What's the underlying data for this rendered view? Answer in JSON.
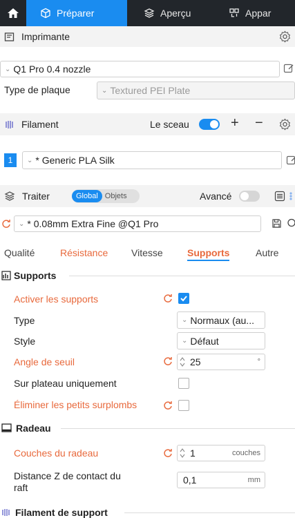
{
  "topbar": {
    "tabs": [
      {
        "label": "Préparer"
      },
      {
        "label": "Aperçu"
      },
      {
        "label": "Appar"
      }
    ]
  },
  "printer": {
    "title": "Imprimante",
    "preset": "Q1 Pro 0.4 nozzle",
    "plate_label": "Type de plaque",
    "plate_value": "Textured PEI Plate"
  },
  "filament": {
    "title": "Filament",
    "sceau_label": "Le sceau",
    "plus": "+",
    "minus": "−",
    "slot_number": "1",
    "preset": "* Generic PLA Silk"
  },
  "process": {
    "title": "Traiter",
    "global_label": "Global",
    "objets_label": "Objets",
    "advanced_label": "Avancé",
    "preset": "* 0.08mm Extra Fine @Q1 Pro"
  },
  "tabs": [
    {
      "label": "Qualité"
    },
    {
      "label": "Résistance"
    },
    {
      "label": "Vitesse"
    },
    {
      "label": "Supports"
    },
    {
      "label": "Autre"
    }
  ],
  "groups": {
    "supports": {
      "title": "Supports",
      "enable_label": "Activer les supports",
      "enable_checked": true,
      "type_label": "Type",
      "type_value": "Normaux (au...",
      "style_label": "Style",
      "style_value": "Défaut",
      "threshold_label": "Angle de seuil",
      "threshold_value": "25",
      "threshold_unit": "°",
      "build_plate_label": "Sur plateau uniquement",
      "remove_small_label": "Éliminer les petits surplombs"
    },
    "raft": {
      "title": "Radeau",
      "layers_label": "Couches du radeau",
      "layers_value": "1",
      "layers_unit": "couches",
      "zdist_label_1": "Distance Z de contact du",
      "zdist_label_2": "raft",
      "zdist_value": "0,1",
      "zdist_unit": "mm"
    },
    "support_filament": {
      "title": "Filament de support"
    }
  },
  "colors": {
    "accent": "#1a8cf0",
    "changed": "#e8693c",
    "topbar": "#22262b"
  }
}
